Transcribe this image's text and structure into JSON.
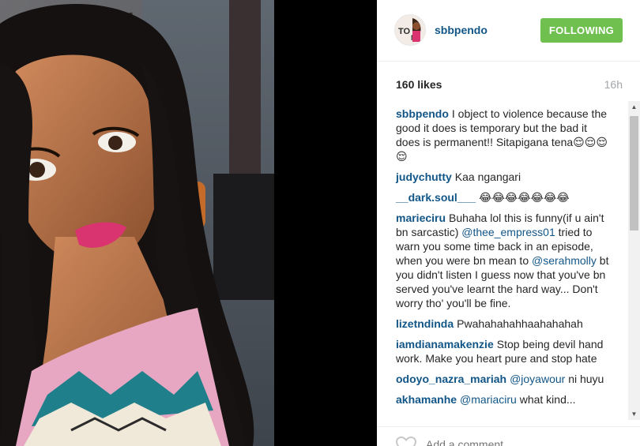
{
  "post": {
    "username": "sbbpendo",
    "follow_label": "FOLLOWING",
    "likes": "160 likes",
    "time": "16h",
    "add_comment_placeholder": "Add a comment..."
  },
  "comments": [
    {
      "user": "sbbpendo",
      "parts": [
        {
          "t": "text",
          "v": "I object to violence because the good it does is temporary but the bad it does is permanent!! Sitapigana tena😌😌😌😌"
        }
      ]
    },
    {
      "user": "judychutty",
      "parts": [
        {
          "t": "text",
          "v": "Kaa ngangari"
        }
      ]
    },
    {
      "user": "__dark.soul___",
      "parts": [
        {
          "t": "text",
          "v": "😂😂😂😂😂😂😂"
        }
      ]
    },
    {
      "user": "marieciru",
      "parts": [
        {
          "t": "text",
          "v": "Buhaha lol this is funny(if u ain't bn sarcastic) "
        },
        {
          "t": "mention",
          "v": "@thee_empress01"
        },
        {
          "t": "text",
          "v": " tried to warn you some time back in an episode, when you were bn mean to "
        },
        {
          "t": "mention",
          "v": "@serahmolly"
        },
        {
          "t": "text",
          "v": " bt you didn't listen I guess now that you've bn served you've learnt the hard way... Don't worry tho' you'll be fine."
        }
      ]
    },
    {
      "user": "lizetndinda",
      "parts": [
        {
          "t": "text",
          "v": "Pwahahahahhaahahahah"
        }
      ]
    },
    {
      "user": "iamdianamakenzie",
      "parts": [
        {
          "t": "text",
          "v": "Stop being devil hand work. Make you heart pure and stop hate"
        }
      ]
    },
    {
      "user": "odoyo_nazra_mariah",
      "parts": [
        {
          "t": "mention",
          "v": "@joyawour"
        },
        {
          "t": "text",
          "v": " ni huyu"
        }
      ]
    },
    {
      "user": "akhamanhe",
      "parts": [
        {
          "t": "mention",
          "v": "@mariaciru"
        },
        {
          "t": "text",
          "v": " what kind..."
        }
      ]
    }
  ],
  "icons": {
    "heart": "heart-icon",
    "scroll_up": "scroll-up-icon",
    "scroll_down": "scroll-down-icon"
  },
  "colors": {
    "username_blue": "#125688",
    "follow_green": "#70c050",
    "time_gray": "#a5a7aa"
  }
}
